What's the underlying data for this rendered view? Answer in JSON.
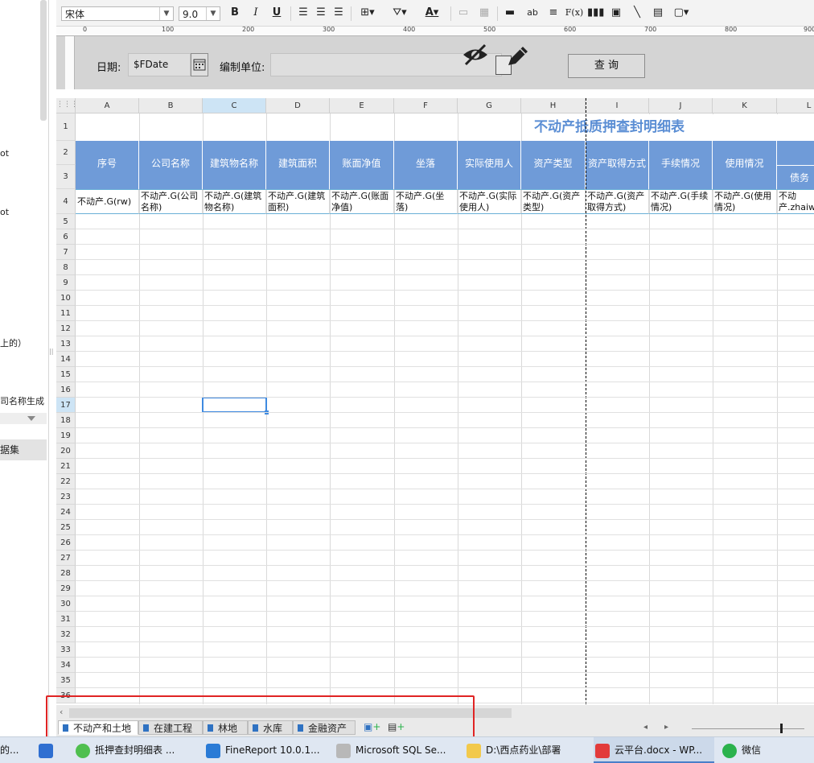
{
  "sidebar": {
    "items": [
      "ot",
      "ot",
      "上的）",
      "司名称生成"
    ],
    "dataset_label": "据集"
  },
  "toolbar": {
    "font_family": "宋体",
    "font_size": "9.0",
    "bold": "B",
    "italic": "I",
    "underline": "U",
    "text_label": "ab",
    "formula": "F(x)"
  },
  "ruler": {
    "labels": [
      "0",
      "100",
      "200",
      "300",
      "400",
      "500",
      "600",
      "700",
      "800",
      "900"
    ]
  },
  "params": {
    "date_label": "日期:",
    "date_value": "$FDate",
    "unit_label": "编制单位:",
    "query_button": "查 询"
  },
  "grid": {
    "columns": [
      "A",
      "B",
      "C",
      "D",
      "E",
      "F",
      "G",
      "H",
      "I",
      "J",
      "K",
      "L"
    ],
    "rows": [
      "1",
      "2",
      "3",
      "4",
      "5",
      "6",
      "7",
      "8",
      "9",
      "10",
      "11",
      "12",
      "13",
      "14",
      "15",
      "16",
      "17",
      "18",
      "19",
      "20",
      "21",
      "22",
      "23",
      "24",
      "25",
      "26",
      "27",
      "28",
      "29",
      "30",
      "31",
      "32",
      "33",
      "34",
      "35",
      "36"
    ],
    "title": "不动产抵质押查封明细表",
    "headers": [
      "序号",
      "公司名称",
      "建筑物名称",
      "建筑面积",
      "账面净值",
      "坐落",
      "实际使用人",
      "资产类型",
      "资产取得方式",
      "手续情况",
      "使用情况",
      "债务名"
    ],
    "data_row": [
      "不动产.G(rw)",
      "不动产.G(公司名称)",
      "不动产.G(建筑物名称)",
      "不动产.G(建筑面积)",
      "不动产.G(账面净值)",
      "不动产.G(坐落)",
      "不动产.G(实际使用人)",
      "不动产.G(资产类型)",
      "不动产.G(资产取得方式)",
      "不动产.G(手续情况)",
      "不动产.G(使用情况)",
      "不动产.zhaiwum"
    ]
  },
  "sheets": {
    "tabs": [
      "不动产和土地",
      "在建工程",
      "林地",
      "水库",
      "金融资产"
    ],
    "active": 0
  },
  "taskbar": {
    "items": [
      "的...",
      "抵押查封明细表 ...",
      "FineReport 10.0.1...",
      "Microsoft SQL Se...",
      "D:\\西点药业\\部署",
      "云平台.docx - WP...",
      "微信"
    ]
  }
}
